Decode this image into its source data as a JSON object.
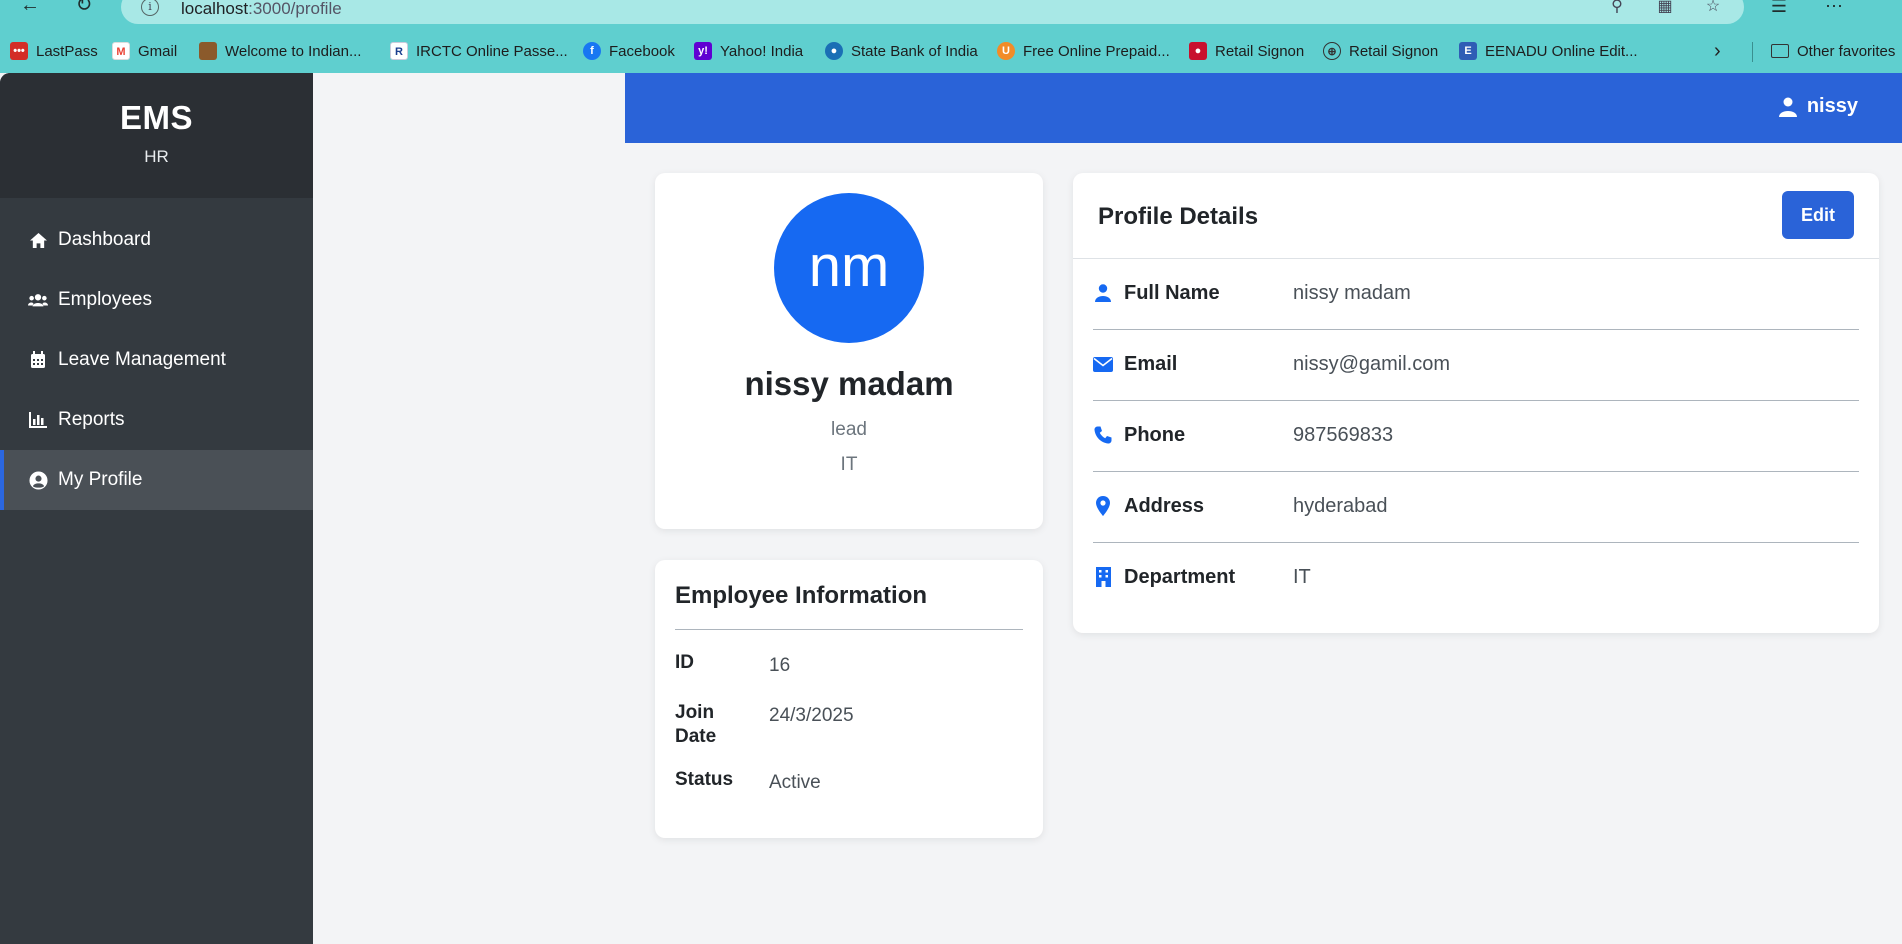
{
  "browser": {
    "url_host": "localhost",
    "url_path": ":3000/profile",
    "bookmarks": [
      {
        "label": "LastPass",
        "icon": "lastpass-icon",
        "color": "#d32d27"
      },
      {
        "label": "Gmail",
        "icon": "gmail-icon",
        "color": "#ea4335"
      },
      {
        "label": "Welcome to Indian...",
        "icon": "indian-site-icon",
        "color": "#8b5a2b"
      },
      {
        "label": "IRCTC Online Passe...",
        "icon": "irctc-icon",
        "color": "#1b3f8f"
      },
      {
        "label": "Facebook",
        "icon": "facebook-icon",
        "color": "#1877f2"
      },
      {
        "label": "Yahoo! India",
        "icon": "yahoo-icon",
        "color": "#6001d2"
      },
      {
        "label": "State Bank of India",
        "icon": "sbi-icon",
        "color": "#1a6fb5"
      },
      {
        "label": "Free Online Prepaid...",
        "icon": "prepaid-icon",
        "color": "#f28c28"
      },
      {
        "label": "Retail Signon",
        "icon": "retail-signon-icon",
        "color": "#c8102e"
      },
      {
        "label": "Retail Signon",
        "icon": "globe-icon",
        "color": "#333333"
      },
      {
        "label": "EENADU Online Edit...",
        "icon": "eenadu-icon",
        "color": "#2f5db5"
      }
    ],
    "other_favorites": "Other favorites"
  },
  "sidebar": {
    "brand_title": "EMS",
    "brand_subtitle": "HR",
    "items": [
      {
        "label": "Dashboard",
        "icon": "home-icon",
        "active": false
      },
      {
        "label": "Employees",
        "icon": "users-icon",
        "active": false
      },
      {
        "label": "Leave Management",
        "icon": "calendar-icon",
        "active": false
      },
      {
        "label": "Reports",
        "icon": "chart-icon",
        "active": false
      },
      {
        "label": "My Profile",
        "icon": "user-circle-icon",
        "active": true
      }
    ]
  },
  "topbar": {
    "username": "nissy"
  },
  "profile_card": {
    "initials": "nm",
    "name": "nissy madam",
    "role": "lead",
    "department": "IT"
  },
  "employee_info": {
    "title": "Employee Information",
    "rows": [
      {
        "label": "ID",
        "value": "16"
      },
      {
        "label": "Join Date",
        "value": "24/3/2025"
      },
      {
        "label": "Status",
        "value": "Active"
      }
    ]
  },
  "profile_details": {
    "title": "Profile Details",
    "edit_label": "Edit",
    "rows": [
      {
        "label": "Full Name",
        "value": "nissy madam",
        "icon": "user-icon"
      },
      {
        "label": "Email",
        "value": "nissy@gamil.com",
        "icon": "envelope-icon"
      },
      {
        "label": "Phone",
        "value": "987569833",
        "icon": "phone-icon"
      },
      {
        "label": "Address",
        "value": "hyderabad",
        "icon": "map-pin-icon"
      },
      {
        "label": "Department",
        "value": "IT",
        "icon": "building-icon"
      }
    ]
  },
  "colors": {
    "sidebar_bg": "#343a40",
    "primary": "#2a63d8",
    "avatar": "#1669f2",
    "browser_bg": "#5fcfcf"
  }
}
